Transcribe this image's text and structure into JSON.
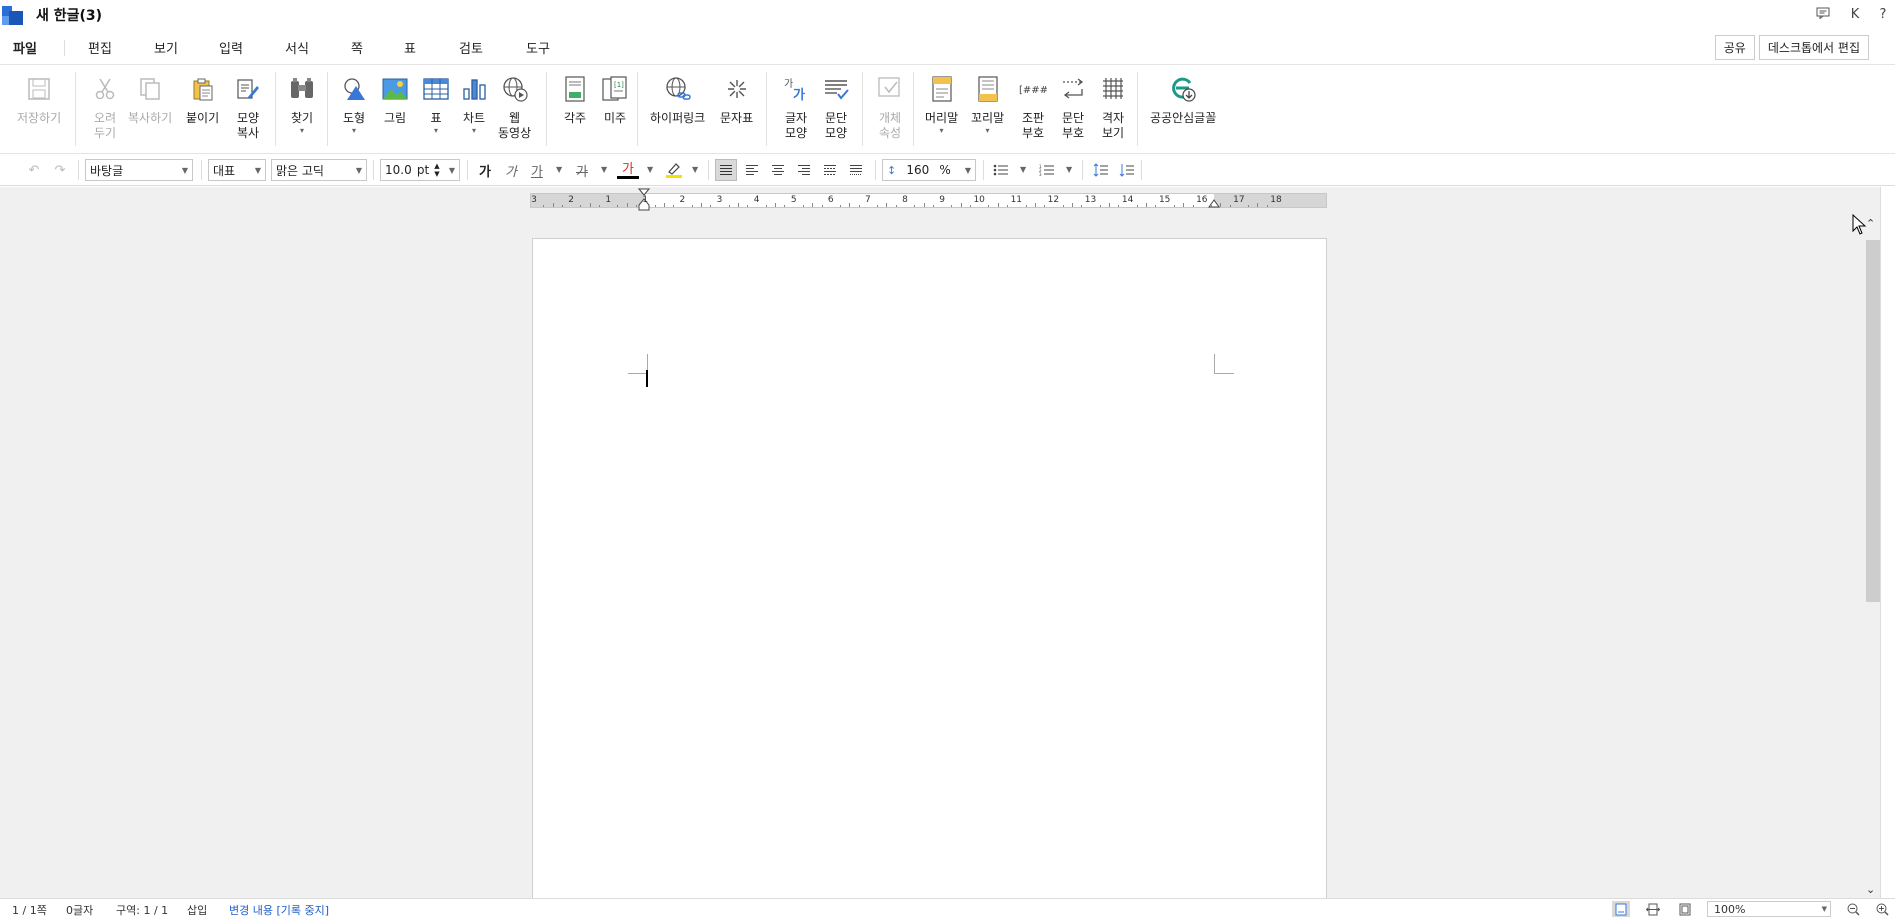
{
  "window": {
    "title": "새 한글(3)",
    "right_icons": [
      "chat-icon",
      "K",
      "?"
    ]
  },
  "menubar": {
    "file": "파일",
    "items": [
      "편집",
      "보기",
      "입력",
      "서식",
      "쪽",
      "표",
      "검토",
      "도구"
    ],
    "share": "공유",
    "desktop_edit": "데스크톱에서 편집"
  },
  "ribbon": {
    "save": "저장하기",
    "cut_l1": "오려",
    "cut_l2": "두기",
    "copy": "복사하기",
    "paste": "붙이기",
    "format_copy_l1": "모양",
    "format_copy_l2": "복사",
    "find": "찾기",
    "shape": "도형",
    "picture": "그림",
    "table": "표",
    "chart": "차트",
    "web_l1": "웹",
    "web_l2": "동영상",
    "footnote": "각주",
    "endnote": "미주",
    "hyperlink": "하이퍼링크",
    "char_map": "문자표",
    "char_shape_l1": "글자",
    "char_shape_l2": "모양",
    "para_shape_l1": "문단",
    "para_shape_l2": "모양",
    "obj_prop_l1": "개체",
    "obj_prop_l2": "속성",
    "header": "머리말",
    "footer": "꼬리말",
    "code_l1": "조판",
    "code_l2": "부호",
    "para_mark_l1": "문단",
    "para_mark_l2": "부호",
    "grid_l1": "격자",
    "grid_l2": "보기",
    "public_font": "공공안심글꼴"
  },
  "format_bar": {
    "style": "바탕글",
    "lang": "대표",
    "font": "맑은 고딕",
    "size": "10.0",
    "size_unit": "pt",
    "bold": "가",
    "italic": "가",
    "underline": "가",
    "strike": "가",
    "font_color": "가",
    "line_spacing": "160",
    "line_spacing_unit": "%"
  },
  "ruler": {
    "labels": [
      "3",
      "2",
      "1",
      "1",
      "2",
      "3",
      "4",
      "5",
      "6",
      "7",
      "8",
      "9",
      "10",
      "11",
      "12",
      "13",
      "14",
      "15",
      "16",
      "17",
      "18"
    ]
  },
  "statusbar": {
    "page": "1 / 1쪽",
    "chars": "0글자",
    "section": "구역: 1 / 1",
    "insert": "삽입",
    "track": "변경 내용 [기록 중지]",
    "zoom": "100%"
  },
  "colors": {
    "accent": "#1e5fc8",
    "workspace_bg": "#f0f0f0",
    "ruler_shade": "#d6d6d6"
  }
}
